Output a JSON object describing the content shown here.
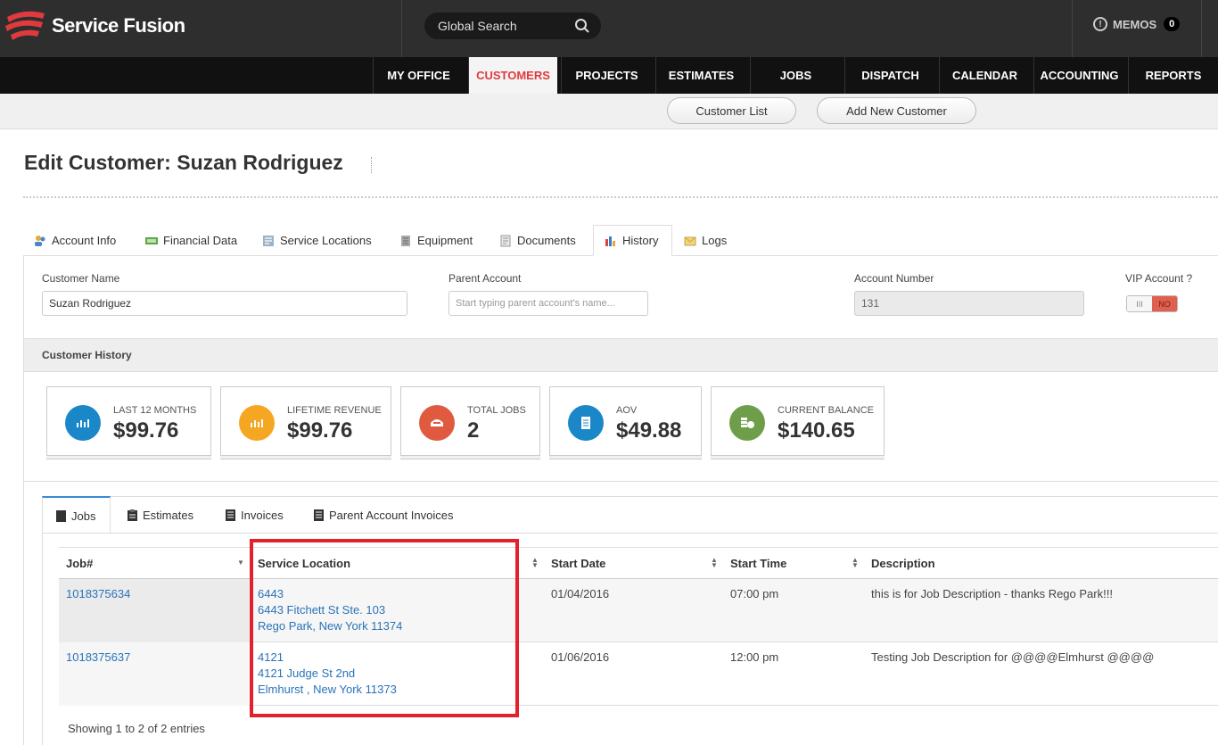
{
  "app": {
    "name": "Service Fusion"
  },
  "search": {
    "placeholder": "Global Search"
  },
  "memos": {
    "label": "MEMOS",
    "count": "0"
  },
  "nav": [
    {
      "label": "MY OFFICE"
    },
    {
      "label": "CUSTOMERS"
    },
    {
      "label": "PROJECTS"
    },
    {
      "label": "ESTIMATES"
    },
    {
      "label": "JOBS"
    },
    {
      "label": "DISPATCH"
    },
    {
      "label": "CALENDAR"
    },
    {
      "label": "ACCOUNTING"
    },
    {
      "label": "REPORTS"
    }
  ],
  "subnav": {
    "customer_list": "Customer List",
    "add_new": "Add New Customer"
  },
  "page": {
    "title": "Edit Customer: Suzan Rodriguez"
  },
  "tabs": [
    {
      "label": "Account Info"
    },
    {
      "label": "Financial Data"
    },
    {
      "label": "Service Locations"
    },
    {
      "label": "Equipment"
    },
    {
      "label": "Documents"
    },
    {
      "label": "History"
    },
    {
      "label": "Logs"
    }
  ],
  "form": {
    "customer_name_label": "Customer Name",
    "customer_name_value": "Suzan Rodriguez",
    "parent_account_label": "Parent Account",
    "parent_account_placeholder": "Start typing parent account's name...",
    "account_number_label": "Account Number",
    "account_number_value": "131",
    "vip_label": "VIP Account ?",
    "vip_off": "III",
    "vip_value": "NO"
  },
  "history": {
    "title": "Customer History",
    "stats": [
      {
        "label": "LAST 12 MONTHS",
        "value": "$99.76",
        "color": "#1a87c9"
      },
      {
        "label": "LIFETIME REVENUE",
        "value": "$99.76",
        "color": "#f5a623"
      },
      {
        "label": "TOTAL JOBS",
        "value": "2",
        "color": "#e05a40"
      },
      {
        "label": "AOV",
        "value": "$49.88",
        "color": "#1a87c9"
      },
      {
        "label": "CURRENT BALANCE",
        "value": "$140.65",
        "color": "#6f9e4a"
      }
    ]
  },
  "subtabs": [
    {
      "label": "Jobs"
    },
    {
      "label": "Estimates"
    },
    {
      "label": "Invoices"
    },
    {
      "label": "Parent Account Invoices"
    }
  ],
  "table": {
    "headers": [
      "Job#",
      "Service Location",
      "Start Date",
      "Start Time",
      "Description"
    ],
    "rows": [
      {
        "job": "1018375634",
        "loc1": "6443",
        "loc2": "6443 Fitchett St Ste. 103",
        "loc3": "Rego Park, New York 11374",
        "date": "01/04/2016",
        "time": "07:00 pm",
        "desc": "this is for Job Description - thanks Rego Park!!!"
      },
      {
        "job": "1018375637",
        "loc1": "4121",
        "loc2": "4121 Judge St 2nd",
        "loc3": "Elmhurst , New York 11373",
        "date": "01/06/2016",
        "time": "12:00 pm",
        "desc": "Testing Job Description for @@@@Elmhurst @@@@"
      }
    ],
    "showing": "Showing 1 to 2 of 2 entries"
  }
}
